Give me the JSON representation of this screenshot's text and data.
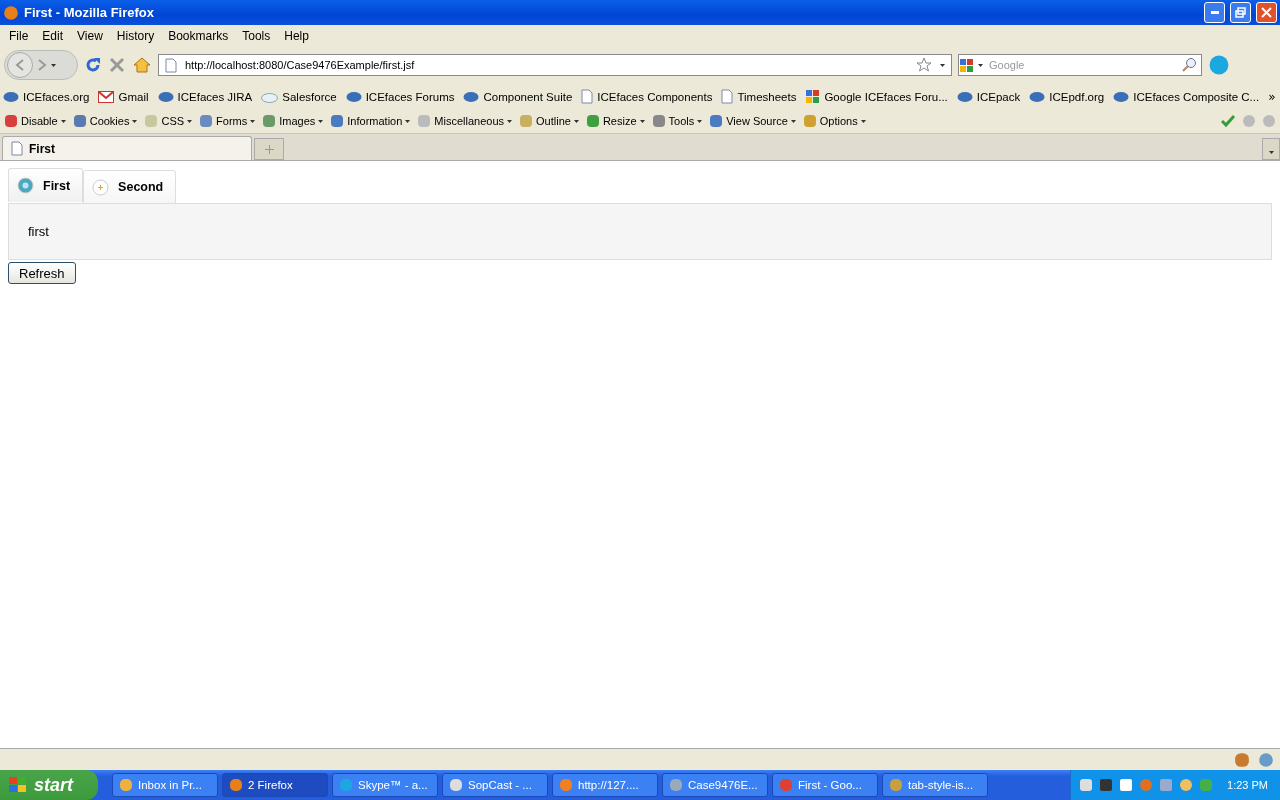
{
  "window": {
    "title": "First - Mozilla Firefox"
  },
  "menu": [
    "File",
    "Edit",
    "View",
    "History",
    "Bookmarks",
    "Tools",
    "Help"
  ],
  "nav": {
    "url": "http://localhost:8080/Case9476Example/first.jsf",
    "search_placeholder": "Google"
  },
  "bookmarks": [
    {
      "label": "ICEfaces.org",
      "kind": "logo"
    },
    {
      "label": "Gmail",
      "kind": "mail"
    },
    {
      "label": "ICEfaces JIRA",
      "kind": "logo"
    },
    {
      "label": "Salesforce",
      "kind": "cloud"
    },
    {
      "label": "ICEfaces Forums",
      "kind": "logo"
    },
    {
      "label": "Component Suite",
      "kind": "logo"
    },
    {
      "label": "ICEfaces Components",
      "kind": "page"
    },
    {
      "label": "Timesheets",
      "kind": "page"
    },
    {
      "label": "Google ICEfaces Foru...",
      "kind": "google"
    },
    {
      "label": "ICEpack",
      "kind": "logo"
    },
    {
      "label": "ICEpdf.org",
      "kind": "logo"
    },
    {
      "label": "ICEfaces Composite C...",
      "kind": "logo"
    }
  ],
  "overflow": "»",
  "dev_toolbar": [
    "Disable",
    "Cookies",
    "CSS",
    "Forms",
    "Images",
    "Information",
    "Miscellaneous",
    "Outline",
    "Resize",
    "Tools",
    "View Source",
    "Options"
  ],
  "browser_tabs": [
    {
      "label": "First",
      "selected": true
    }
  ],
  "page": {
    "tabs": [
      {
        "label": "First",
        "selected": true
      },
      {
        "label": "Second",
        "selected": false
      }
    ],
    "panel_text": "first",
    "button": "Refresh"
  },
  "taskbar": {
    "start": "start",
    "items": [
      {
        "label": "Inbox in Pr...",
        "selected": false
      },
      {
        "label": "2 Firefox",
        "selected": true
      },
      {
        "label": "Skype™ - a...",
        "selected": false
      },
      {
        "label": "SopCast - ...",
        "selected": false
      },
      {
        "label": "http://127....",
        "selected": false
      },
      {
        "label": "Case9476E...",
        "selected": false
      },
      {
        "label": "First - Goo...",
        "selected": false
      },
      {
        "label": "tab-style-is...",
        "selected": false
      }
    ],
    "clock": "1:23 PM"
  }
}
